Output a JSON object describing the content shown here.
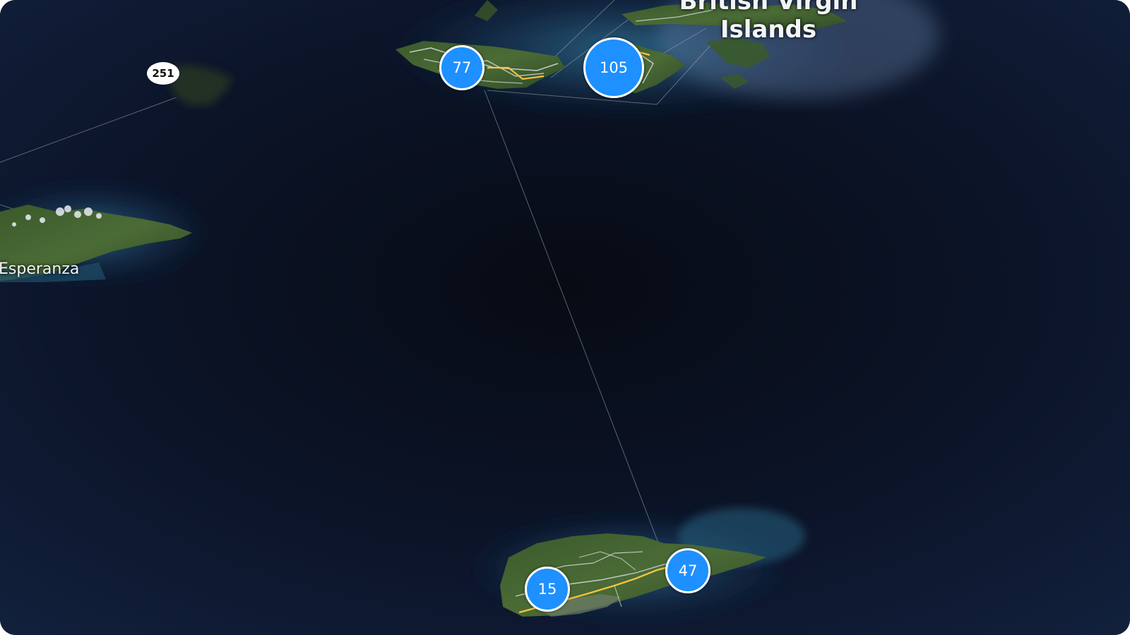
{
  "map": {
    "labels": {
      "region": "British Virgin Islands",
      "region_line1": "British Virgin",
      "region_line2": "Islands",
      "town": "Esperanza"
    },
    "route_shields": [
      {
        "number": "251"
      }
    ],
    "clusters": [
      {
        "count": "77"
      },
      {
        "count": "105"
      },
      {
        "count": "15"
      },
      {
        "count": "47"
      }
    ],
    "colors": {
      "ocean": "#0b1326",
      "cluster_fill": "#1e90ff",
      "cluster_border": "#ffffff",
      "primary_road": "#f5c242",
      "secondary_road": "#d9dde2"
    }
  }
}
